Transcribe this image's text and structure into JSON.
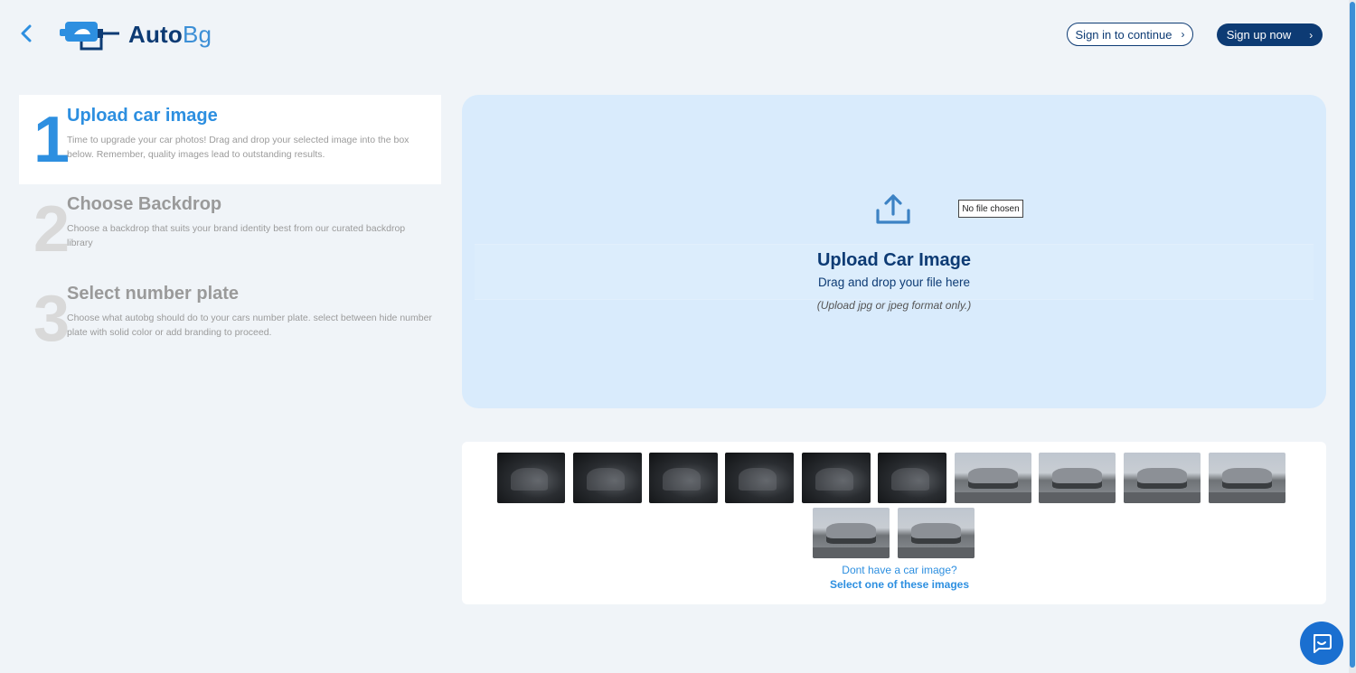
{
  "header": {
    "logo": {
      "part1": "Auto",
      "part2": "Bg"
    },
    "sign_in_label": "Sign in to continue",
    "sign_up_label": "Sign up now",
    "chevron": "›"
  },
  "steps": [
    {
      "number": "1",
      "title": "Upload car image",
      "description": "Time to upgrade your car photos! Drag and drop your selected image into the box below. Remember, quality images lead to outstanding results.",
      "active": true
    },
    {
      "number": "2",
      "title": "Choose Backdrop",
      "description": "Choose a backdrop that suits your brand identity best from our curated backdrop library",
      "active": false
    },
    {
      "number": "3",
      "title": "Select number plate",
      "description": "Choose what autobg should do to your cars number plate. select between hide number plate with solid color or add branding to proceed.",
      "active": false
    }
  ],
  "upload": {
    "file_status": "No file chosen",
    "title": "Upload Car Image",
    "subtitle": "Drag and drop your file here",
    "note": "(Upload jpg or jpeg format only.)"
  },
  "samples": {
    "question": "Dont have a car image?",
    "link_label": "Select one of these images",
    "thumbnails": [
      "interior",
      "interior",
      "interior",
      "interior",
      "interior",
      "interior",
      "exterior",
      "exterior",
      "exterior",
      "exterior",
      "exterior",
      "exterior"
    ]
  },
  "icons": {
    "back": "chevron-left-icon",
    "upload": "upload-icon",
    "chat": "chat-icon"
  },
  "colors": {
    "brand_dark": "#0d3b74",
    "brand_blue": "#2d8fe0",
    "upload_bg": "#d9ebfc",
    "page_bg": "#f0f4f8"
  }
}
